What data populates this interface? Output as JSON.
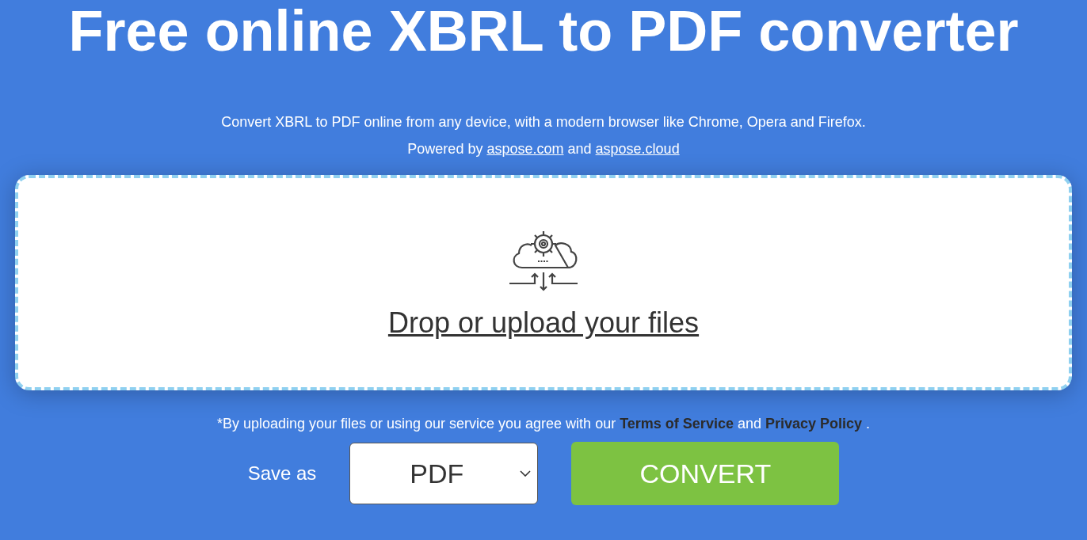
{
  "title": "Free online XBRL to PDF converter",
  "subtitle": "Convert XBRL to PDF online from any device, with a modern browser like Chrome, Opera and Firefox.",
  "powered": {
    "prefix": "Powered by",
    "links": [
      "aspose.com",
      "aspose.cloud"
    ],
    "joiner": "and"
  },
  "dropzone": {
    "label": "Drop or upload your files"
  },
  "terms": {
    "prefix": "*By uploading your files or using our service you agree with our",
    "links": [
      "Terms of Service",
      "Privacy Policy"
    ],
    "joiner": "and",
    "suffix": "."
  },
  "save_as": {
    "label": "Save as",
    "value": "PDF"
  },
  "convert_button": "CONVERT"
}
